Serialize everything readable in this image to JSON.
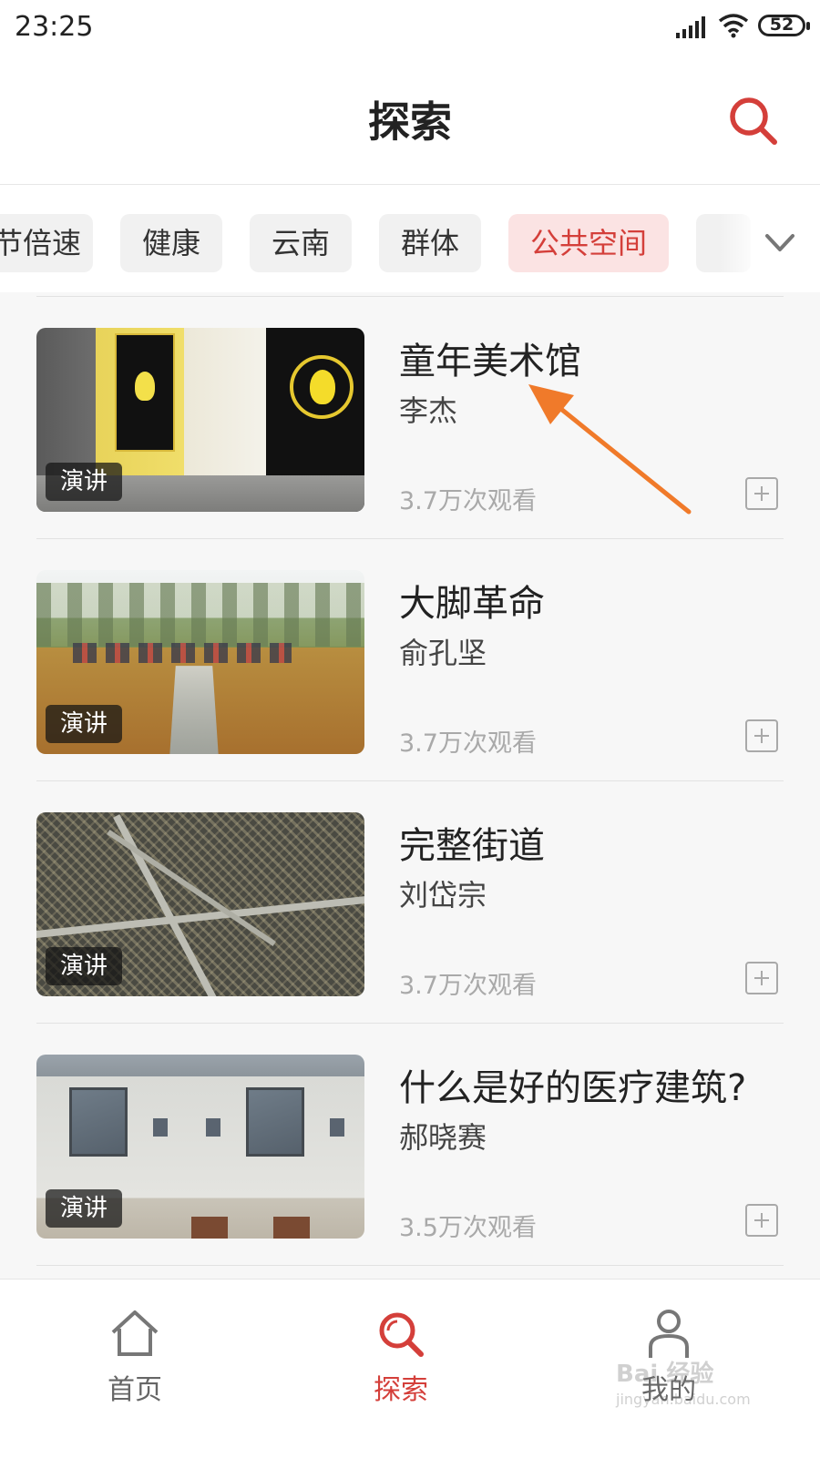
{
  "status_bar": {
    "time": "23:25",
    "battery": "52"
  },
  "header": {
    "title": "探索"
  },
  "tabs": [
    {
      "label": "节倍速",
      "active": false
    },
    {
      "label": "健康",
      "active": false
    },
    {
      "label": "云南",
      "active": false
    },
    {
      "label": "群体",
      "active": false
    },
    {
      "label": "公共空间",
      "active": true
    },
    {
      "label": "",
      "active": false
    }
  ],
  "items": [
    {
      "title": "童年美术馆",
      "author": "李杰",
      "views": "3.7万次观看",
      "badge": "演讲",
      "thumb": "gallery"
    },
    {
      "title": "大脚革命",
      "author": "俞孔坚",
      "views": "3.7万次观看",
      "badge": "演讲",
      "thumb": "field"
    },
    {
      "title": "完整街道",
      "author": "刘岱宗",
      "views": "3.7万次观看",
      "badge": "演讲",
      "thumb": "map"
    },
    {
      "title": "什么是好的医疗建筑?",
      "author": "郝晓赛",
      "views": "3.5万次观看",
      "badge": "演讲",
      "thumb": "building"
    }
  ],
  "bottom_nav": [
    {
      "label": "首页",
      "icon": "home-icon",
      "active": false
    },
    {
      "label": "探索",
      "icon": "search-icon",
      "active": true
    },
    {
      "label": "我的",
      "icon": "user-icon",
      "active": false
    }
  ],
  "watermark": {
    "text": "Bai 经验",
    "url": "jingyan.baidu.com"
  },
  "colors": {
    "accent": "#d43f3a",
    "annotation_arrow": "#f07a2a"
  }
}
